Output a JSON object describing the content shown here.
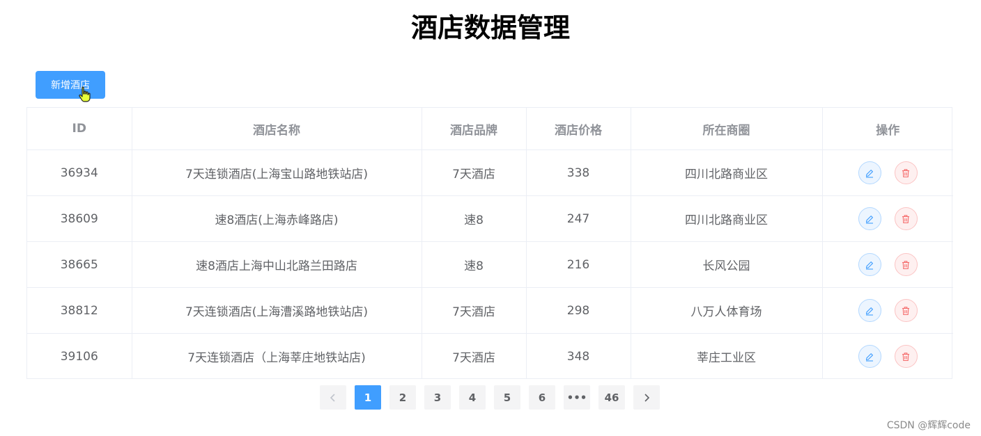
{
  "page": {
    "title": "酒店数据管理"
  },
  "toolbar": {
    "add_label": "新增酒店"
  },
  "table": {
    "columns": [
      "ID",
      "酒店名称",
      "酒店品牌",
      "酒店价格",
      "所在商圈",
      "操作"
    ],
    "rows": [
      {
        "id": "36934",
        "name": "7天连锁酒店(上海宝山路地铁站店)",
        "brand": "7天酒店",
        "price": "338",
        "area": "四川北路商业区"
      },
      {
        "id": "38609",
        "name": "速8酒店(上海赤峰路店)",
        "brand": "速8",
        "price": "247",
        "area": "四川北路商业区"
      },
      {
        "id": "38665",
        "name": "速8酒店上海中山北路兰田路店",
        "brand": "速8",
        "price": "216",
        "area": "长风公园"
      },
      {
        "id": "38812",
        "name": "7天连锁酒店(上海漕溪路地铁站店)",
        "brand": "7天酒店",
        "price": "298",
        "area": "八万人体育场"
      },
      {
        "id": "39106",
        "name": "7天连锁酒店（上海莘庄地铁站店)",
        "brand": "7天酒店",
        "price": "348",
        "area": "莘庄工业区"
      }
    ],
    "actions": {
      "edit_icon": "edit-icon",
      "delete_icon": "delete-icon"
    }
  },
  "pagination": {
    "pages": [
      "1",
      "2",
      "3",
      "4",
      "5",
      "6",
      "•••",
      "46"
    ],
    "current": "1",
    "prev_icon": "chevron-left-icon",
    "next_icon": "chevron-right-icon"
  },
  "watermark": "CSDN @辉辉code",
  "colors": {
    "primary": "#409eff",
    "danger": "#f56c6c",
    "border": "#ebeef5"
  }
}
